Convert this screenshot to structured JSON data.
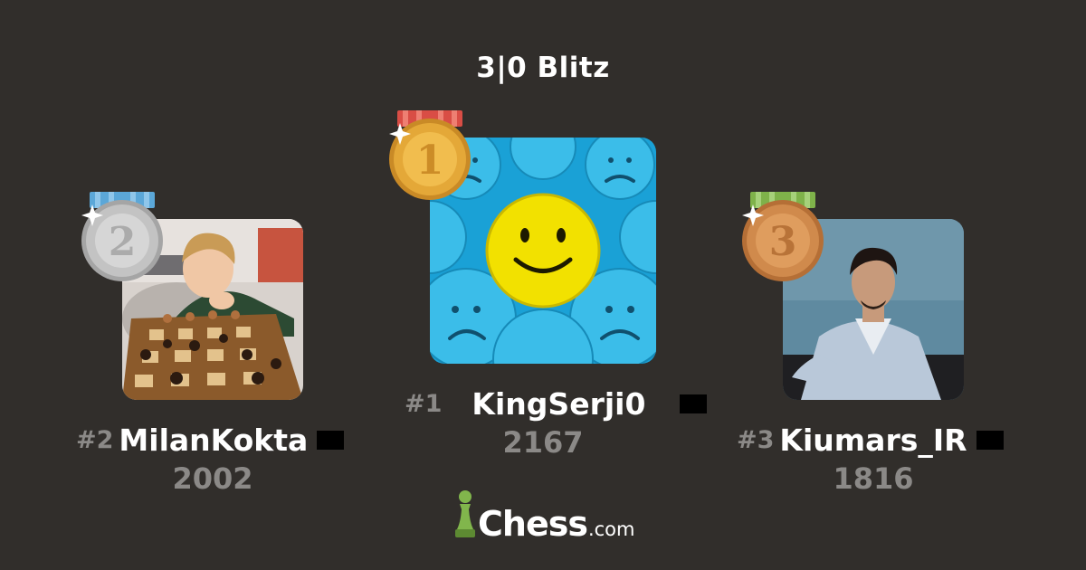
{
  "title": "3|0 Blitz",
  "players": {
    "first": {
      "rank": "#1",
      "username": "KingSerji0",
      "rating": "2167",
      "medal_number": "1"
    },
    "second": {
      "rank": "#2",
      "username": "MilanKokta",
      "rating": "2002",
      "medal_number": "2"
    },
    "third": {
      "rank": "#3",
      "username": "Kiumars_IR",
      "rating": "1816",
      "medal_number": "3"
    }
  },
  "logo": {
    "wordmark": "Chess",
    "domain": ".com",
    "icon": "pawn-icon"
  },
  "colors": {
    "background": "#312e2b",
    "gold": "#e4a838",
    "silver": "#c3c3c3",
    "bronze": "#d08a4c",
    "ribbon_gold": "#d94d45",
    "ribbon_silver": "#5ba7d8",
    "ribbon_bronze": "#7fb24a",
    "brand_green": "#81b64c"
  }
}
